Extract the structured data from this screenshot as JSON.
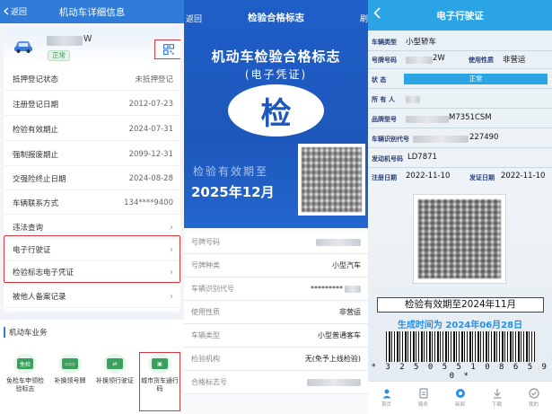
{
  "panel1": {
    "back_label": "返回",
    "title": "机动车详细信息",
    "plate_suffix": "W",
    "status": "正常",
    "rows": [
      {
        "label": "抵押登记状态",
        "value": "未抵押登记"
      },
      {
        "label": "注册登记日期",
        "value": "2012-07-23"
      },
      {
        "label": "检验有效期止",
        "value": "2024-07-31"
      },
      {
        "label": "强制报废期止",
        "value": "2099-12-31"
      },
      {
        "label": "交强险终止日期",
        "value": "2024-08-28"
      },
      {
        "label": "车辆联系方式",
        "value": "134****9400"
      }
    ],
    "links": [
      {
        "label": "违法查询"
      },
      {
        "label": "电子行驶证"
      },
      {
        "label": "检验标志电子凭证"
      },
      {
        "label": "被他人备案记录"
      }
    ],
    "biz_title": "机动车业务",
    "biz_items": [
      {
        "label": "免检车申领检验标志",
        "icon_text": "免检"
      },
      {
        "label": "补换领号牌",
        "icon_text": ""
      },
      {
        "label": "补换领行驶证",
        "icon_text": ""
      },
      {
        "label": "城市货车通行码",
        "icon_text": ""
      }
    ]
  },
  "panel2": {
    "back_label": "返回",
    "title": "检验合格标志",
    "right_label": "刷",
    "main_title": "机动车检验合格标志",
    "subtitle": "(电子凭证)",
    "seal_char": "检",
    "valid_label": "检验有效期至",
    "valid_value": "2025年12月",
    "rows": [
      {
        "label": "号牌号码",
        "value": ""
      },
      {
        "label": "号牌种类",
        "value": "小型汽车"
      },
      {
        "label": "车辆识别代号",
        "value": "*********"
      },
      {
        "label": "使用性质",
        "value": "非营运"
      },
      {
        "label": "车辆类型",
        "value": "小型普通客车"
      },
      {
        "label": "检验机构",
        "value": "无(免予上线检验)"
      },
      {
        "label": "合格标志号",
        "value": ""
      }
    ]
  },
  "panel3": {
    "title": "电子行驶证",
    "vehicle_type_label": "车辆类型",
    "vehicle_type": "小型轿车",
    "plate_label": "号牌号码",
    "plate_suffix": "2W",
    "use_label": "使用性质",
    "use_value": "非营运",
    "state_label": "状 态",
    "state_value": "正常",
    "owner_label": "所 有 人",
    "brand_label": "品牌型号",
    "brand_suffix": "M7351CSM",
    "vin_label": "车辆识别代号",
    "vin_suffix": "227490",
    "engine_label": "发动机号码",
    "engine_value": "LD7871",
    "reg_label": "注册日期",
    "reg_value": "2022-11-10",
    "issue_label": "发证日期",
    "issue_value": "2022-11-10",
    "valid_text": "检验有效期至2024年11月",
    "gen_text": "生成时间为 2024年06月28日",
    "barcode_number": "* 3 2 5 0 5 5 1 0 8 6 5 9 0 *",
    "tabs": [
      {
        "label": "首页",
        "icon": "person-icon"
      },
      {
        "label": "服务",
        "icon": "doc-icon"
      },
      {
        "label": "新闻",
        "icon": "circle-icon"
      },
      {
        "label": "下载",
        "icon": "download-icon"
      },
      {
        "label": "我的",
        "icon": "check-icon"
      }
    ]
  }
}
